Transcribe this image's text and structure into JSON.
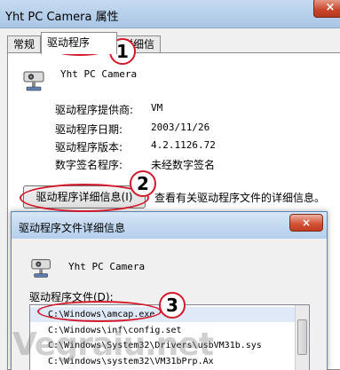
{
  "window": {
    "title": "Yht PC Camera 属性",
    "close_label": "×",
    "tabs": [
      {
        "label": "常规"
      },
      {
        "label": "驱动程序"
      },
      {
        "label": "详细信息"
      }
    ]
  },
  "driver_tab": {
    "device_name": "Yht PC Camera",
    "fields": [
      {
        "label": "驱动程序提供商:",
        "value": "VM"
      },
      {
        "label": "驱动程序日期:",
        "value": "2003/11/26"
      },
      {
        "label": "驱动程序版本:",
        "value": "4.2.1126.72"
      },
      {
        "label": "数字签名程序:",
        "value": "未经数字签名"
      }
    ],
    "details_button": "驱动程序详细信息(I)",
    "details_description": "查看有关驱动程序文件的详细信息。"
  },
  "details_dialog": {
    "title": "驱动程序文件详细信息",
    "close_label": "×",
    "device_name": "Yht PC Camera",
    "files_label": "驱动程序文件(D):",
    "files": [
      "C:\\Windows\\amcap.exe",
      "C:\\Windows\\inf\\config.set",
      "C:\\Windows\\System32\\Drivers\\usbVM31b.sys",
      "C:\\Windows\\system32\\VM31bPrp.Ax"
    ],
    "selected_index": 0
  },
  "annotations": [
    "1",
    "2",
    "3"
  ],
  "watermark": "Vegraiu.net",
  "colors": {
    "annotation_red": "#d31a2c",
    "title_bar": "#b6cfea",
    "selection": "#dfe9f7"
  }
}
